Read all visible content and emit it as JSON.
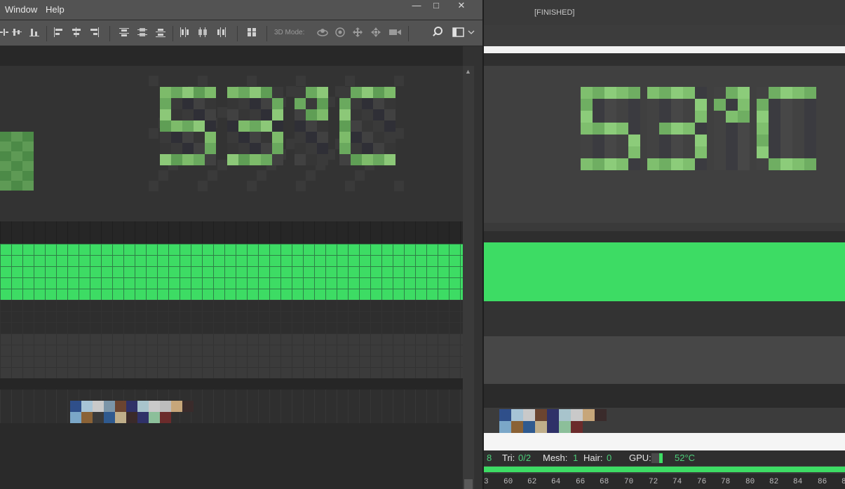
{
  "menubar": {
    "items": [
      "Window",
      "Help"
    ],
    "window_buttons": {
      "minimize": "—",
      "restore": "□",
      "close": "✕"
    }
  },
  "toolbar": {
    "three_d_mode_label": "3D Mode:",
    "icons": [
      "align-top-icon",
      "align-vcenter-icon",
      "align-bottom-icon",
      "align-left-icon",
      "align-hcenter-icon",
      "align-right-icon",
      "distribute-top-icon",
      "distribute-vcenter-icon",
      "distribute-bottom-icon",
      "distribute-left-icon",
      "distribute-hcenter-icon",
      "distribute-right-icon",
      "auto-align-icon",
      "rotate-3d-icon",
      "roll-3d-icon",
      "drag-3d-icon",
      "slide-3d-icon",
      "scale-3d-icon",
      "search-icon",
      "workspace-icon"
    ]
  },
  "canvas": {
    "temperature_text": "53°C",
    "colors": {
      "green_bright": "#3ddc64",
      "green_pixel": "#7dbb6a",
      "bg_dark": "#2b2b2b"
    }
  },
  "preview": {
    "status": "[FINISHED]",
    "temperature_text": "53°C"
  },
  "stats": {
    "partial_value": "8",
    "tri_label": "Tri:",
    "tri_value": "0/2",
    "mesh_label": "Mesh:",
    "mesh_value": "1",
    "hair_label": "Hair:",
    "hair_value": "0",
    "gpu_label": "GPU:",
    "gpu_temp": "52°C",
    "gpu_level": 0.3
  },
  "timeline": {
    "ticks": [
      "3",
      "60",
      "62",
      "64",
      "66",
      "68",
      "70",
      "72",
      "74",
      "76",
      "78",
      "80",
      "82",
      "84",
      "86",
      "8"
    ]
  }
}
